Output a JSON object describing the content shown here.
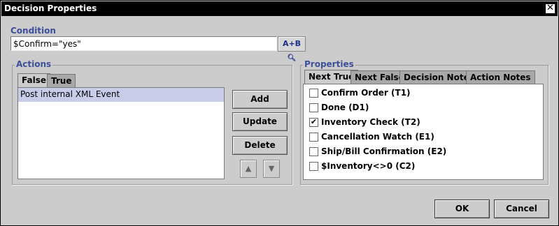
{
  "window": {
    "title": "Decision Properties",
    "close_glyph": "✕"
  },
  "condition": {
    "label": "Condition",
    "value": "$Confirm=\"yes\"",
    "expr_button": "A+B"
  },
  "actions": {
    "label": "Actions",
    "tabs": [
      "False",
      "True"
    ],
    "items": [
      "Post internal XML Event"
    ],
    "buttons": {
      "add": "Add",
      "update": "Update",
      "delete": "Delete"
    }
  },
  "properties": {
    "label": "Properties",
    "tabs": [
      "Next True",
      "Next False",
      "Decision Notes",
      "Action Notes"
    ],
    "options": [
      {
        "label": "Confirm Order (T1)",
        "checked": false
      },
      {
        "label": "Done (D1)",
        "checked": false
      },
      {
        "label": "Inventory Check (T2)",
        "checked": true
      },
      {
        "label": "Cancellation Watch (E1)",
        "checked": false
      },
      {
        "label": "Ship/Bill Confirmation (E2)",
        "checked": false
      },
      {
        "label": "$Inventory<>0 (C2)",
        "checked": false
      }
    ]
  },
  "footer": {
    "ok": "OK",
    "cancel": "Cancel"
  },
  "colors": {
    "accent_label": "#3c4f9a",
    "title_bar": "#000000",
    "selection": "#c8cce8"
  }
}
